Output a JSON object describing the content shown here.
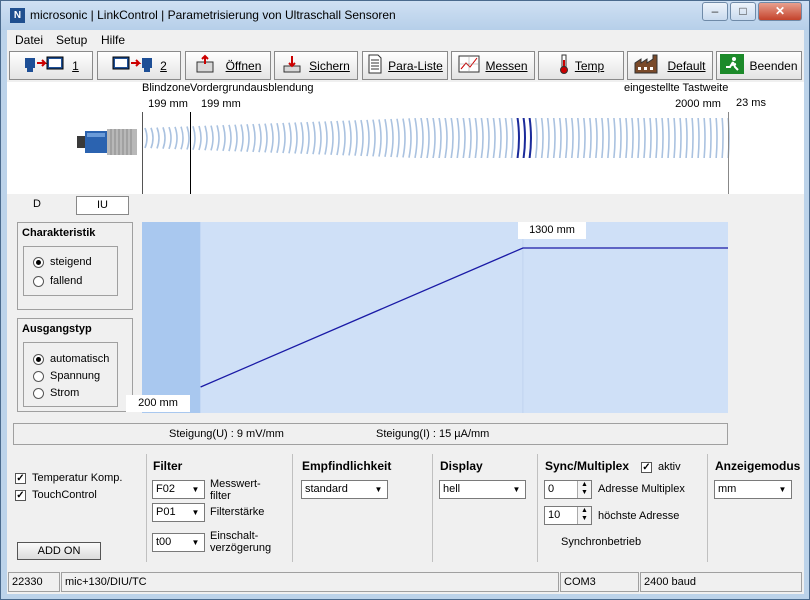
{
  "window": {
    "title": "microsonic | LinkControl | Parametrisierung von Ultraschall Sensoren",
    "app_icon": "microsonic-logo-icon",
    "controls": {
      "minimize": "–",
      "maximize": "□",
      "close": "✕"
    }
  },
  "menu": {
    "items": [
      "Datei",
      "Setup",
      "Hilfe"
    ]
  },
  "toolbar": {
    "buttons": [
      {
        "label": "1",
        "icon": "sensor-to-pc-icon"
      },
      {
        "label": "2",
        "icon": "pc-to-sensor-icon"
      },
      {
        "label": "Öffnen",
        "icon": "open-folder-icon"
      },
      {
        "label": "Sichern",
        "icon": "save-download-icon"
      },
      {
        "label": "Para-Liste",
        "icon": "document-list-icon"
      },
      {
        "label": "Messen",
        "icon": "measure-chart-icon"
      },
      {
        "label": "Temp",
        "icon": "thermometer-icon"
      },
      {
        "label": "Default",
        "icon": "factory-icon"
      },
      {
        "label": "Beenden",
        "icon": "exit-runner-icon"
      }
    ]
  },
  "sensor_view": {
    "blindzone_label": "Blindzone",
    "blindzone_value": "199 mm",
    "foreground_label": "Vordergrundausblendung",
    "foreground_value": "199 mm",
    "range_label": "eingestellte Tastweite",
    "range_value": "2000 mm",
    "response_time": "23 ms"
  },
  "tabs": [
    {
      "label": "D",
      "selected": false
    },
    {
      "label": "IU",
      "selected": true
    }
  ],
  "characteristic": {
    "title": "Charakteristik",
    "options": [
      {
        "label": "steigend",
        "checked": true
      },
      {
        "label": "fallend",
        "checked": false
      }
    ]
  },
  "output_type": {
    "title": "Ausgangstyp",
    "options": [
      {
        "label": "automatisch",
        "checked": true
      },
      {
        "label": "Spannung",
        "checked": false
      },
      {
        "label": "Strom",
        "checked": false
      }
    ]
  },
  "chart_data": {
    "type": "line",
    "title": "",
    "xlabel": "",
    "ylabel": "",
    "annotations": {
      "start_label": "200 mm",
      "end_label": "1300 mm"
    },
    "x": [
      200,
      1300,
      2000
    ],
    "series": [
      {
        "values": [
          0,
          1,
          1
        ]
      }
    ],
    "xlim": [
      0,
      2000
    ],
    "blind_zone_end": 199,
    "colors": {
      "line": "#1a1aa6",
      "area": "#cfe0f7",
      "blind": "#a9c8ef"
    }
  },
  "slope": {
    "u": "Steigung(U) : 9 mV/mm",
    "i": "Steigung(I) : 15 µA/mm"
  },
  "options": {
    "temp_comp": {
      "label": "Temperatur Komp.",
      "checked": true
    },
    "touch_control": {
      "label": "TouchControl",
      "checked": true
    },
    "add_on": "ADD ON"
  },
  "filter": {
    "title": "Filter",
    "filter_value": "F02",
    "filter_label_1": "Messwert-",
    "filter_label_2": "filter",
    "strength_value": "P01",
    "strength_label": "Filterstärke",
    "delay_value": "t00",
    "delay_label_1": "Einschalt-",
    "delay_label_2": "verzögerung"
  },
  "sensitivity": {
    "title": "Empfindlichkeit",
    "value": "standard"
  },
  "display": {
    "title": "Display",
    "value": "hell"
  },
  "sync": {
    "title": "Sync/Multiplex",
    "active_label": "aktiv",
    "active": true,
    "address_value": "0",
    "address_label": "Adresse Multiplex",
    "max_address_value": "10",
    "max_address_label": "höchste Adresse",
    "mode_label": "Synchronbetrieb"
  },
  "display_mode": {
    "title": "Anzeigemodus",
    "value": "mm"
  },
  "status": {
    "serial": "22330",
    "sensor": "mic+130/DIU/TC",
    "port": "COM3",
    "baud": "2400 baud"
  }
}
